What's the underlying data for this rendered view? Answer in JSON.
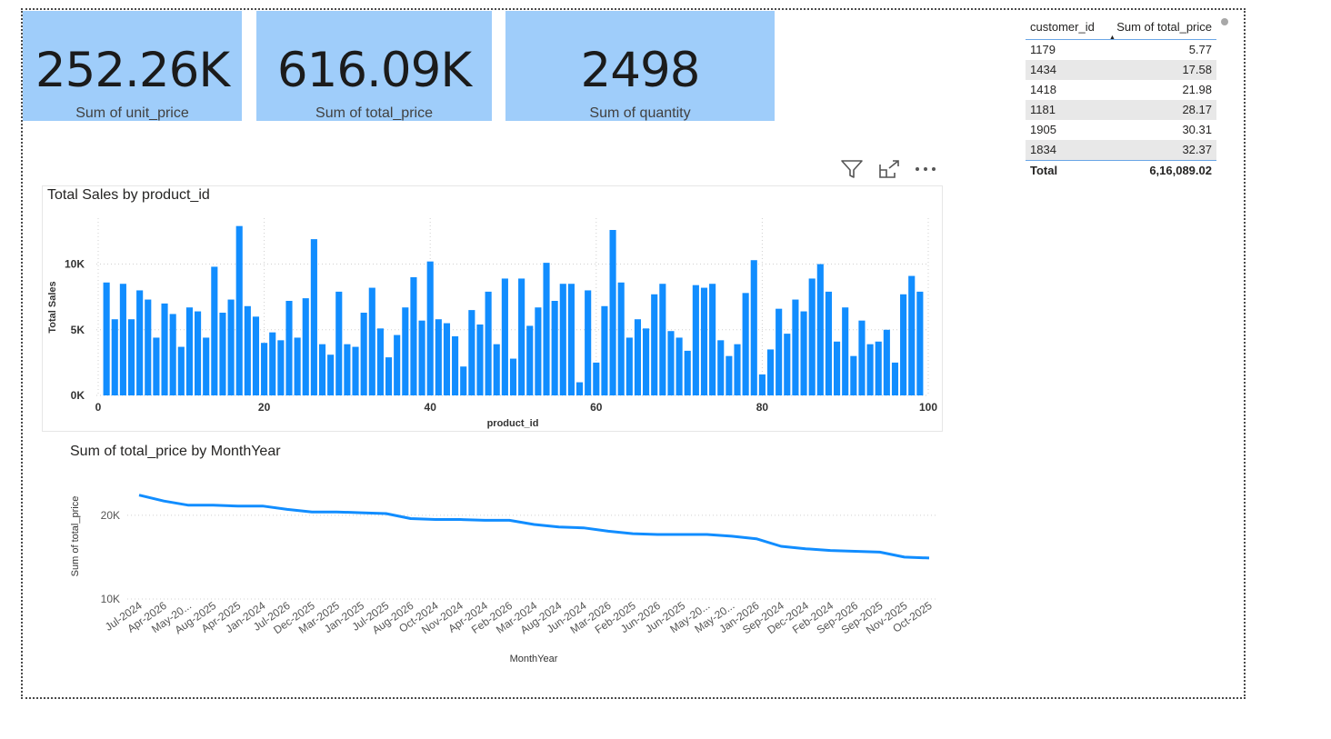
{
  "kpis": [
    {
      "value": "252.26K",
      "label": "Sum of unit_price"
    },
    {
      "value": "616.09K",
      "label": "Sum of total_price"
    },
    {
      "value": "2498",
      "label": "Sum of quantity"
    }
  ],
  "table": {
    "headers": [
      "customer_id",
      "Sum of total_price"
    ],
    "rows": [
      [
        "1179",
        "5.77"
      ],
      [
        "1434",
        "17.58"
      ],
      [
        "1418",
        "21.98"
      ],
      [
        "1181",
        "28.17"
      ],
      [
        "1905",
        "30.31"
      ],
      [
        "1834",
        "32.37"
      ]
    ],
    "total_label": "Total",
    "total_value": "6,16,089.02"
  },
  "toolbar": {
    "icons": [
      "filter-icon",
      "focus-mode-icon",
      "more-options-icon"
    ]
  },
  "colors": {
    "kpi_bg": "#9fcdfa",
    "bar": "#118dff",
    "line": "#118dff"
  },
  "chart_data": [
    {
      "type": "bar",
      "title": "Total Sales by product_id",
      "xlabel": "product_id",
      "ylabel": "Total Sales",
      "xlim": [
        0,
        100
      ],
      "ylim": [
        0,
        13500
      ],
      "xticks": [
        "0",
        "20",
        "40",
        "60",
        "80",
        "100"
      ],
      "yticks": [
        "0K",
        "5K",
        "10K"
      ],
      "grid": true,
      "x": [
        1,
        2,
        3,
        4,
        5,
        6,
        7,
        8,
        9,
        10,
        11,
        12,
        13,
        14,
        15,
        16,
        17,
        18,
        19,
        20,
        21,
        22,
        23,
        24,
        25,
        26,
        27,
        28,
        29,
        30,
        31,
        32,
        33,
        34,
        35,
        36,
        37,
        38,
        39,
        40,
        41,
        42,
        43,
        44,
        45,
        46,
        47,
        48,
        49,
        50,
        51,
        52,
        53,
        54,
        55,
        56,
        57,
        58,
        59,
        60,
        61,
        62,
        63,
        64,
        65,
        66,
        67,
        68,
        69,
        70,
        71,
        72,
        73,
        74,
        75,
        76,
        77,
        78,
        79,
        80,
        81,
        82,
        83,
        84,
        85,
        86,
        87,
        88,
        89,
        90,
        91,
        92,
        93,
        94,
        95,
        96,
        97,
        98,
        99
      ],
      "values": [
        8600,
        5800,
        8500,
        5800,
        8000,
        7300,
        4400,
        7000,
        6200,
        3700,
        6700,
        6400,
        4400,
        9800,
        6300,
        7300,
        12900,
        6800,
        6000,
        4000,
        4800,
        4200,
        7200,
        4400,
        7400,
        11900,
        3900,
        3100,
        7900,
        3900,
        3700,
        6300,
        8200,
        5100,
        2900,
        4600,
        6700,
        9000,
        5700,
        10200,
        5800,
        5500,
        4500,
        2200,
        6500,
        5400,
        7900,
        3900,
        8900,
        2800,
        8900,
        5300,
        6700,
        10100,
        7200,
        8500,
        8500,
        1000,
        8000,
        2500,
        6800,
        12600,
        8600,
        4400,
        5800,
        5100,
        7700,
        8500,
        4900,
        4400,
        3400,
        8400,
        8200,
        8500,
        4200,
        3000,
        3900,
        7800,
        10300,
        1600,
        3500,
        6600,
        4700,
        7300,
        6400,
        8900,
        10000,
        7900,
        4100,
        6700,
        3000,
        5700,
        3900,
        4100,
        5000,
        2500,
        7700,
        9100,
        7900
      ]
    },
    {
      "type": "line",
      "title": "Sum of total_price by MonthYear",
      "xlabel": "MonthYear",
      "ylabel": "Sum of total_price",
      "ylim": [
        10000,
        24000
      ],
      "yticks": [
        "10K",
        "20K"
      ],
      "grid": true,
      "x": [
        "Jul-2024",
        "Apr-2026",
        "May-20...",
        "Aug-2025",
        "Apr-2025",
        "Jan-2024",
        "Jul-2026",
        "Dec-2025",
        "Mar-2025",
        "Jan-2025",
        "Jul-2025",
        "Aug-2026",
        "Oct-2024",
        "Nov-2024",
        "Apr-2024",
        "Feb-2026",
        "Mar-2024",
        "Aug-2024",
        "Jun-2024",
        "Mar-2026",
        "Feb-2025",
        "Jun-2026",
        "Jun-2025",
        "May-20...",
        "May-20...",
        "Jan-2026",
        "Sep-2024",
        "Dec-2024",
        "Feb-2024",
        "Sep-2026",
        "Sep-2025",
        "Nov-2025",
        "Oct-2025"
      ],
      "values": [
        22400,
        21700,
        21200,
        21200,
        21100,
        21100,
        20700,
        20400,
        20400,
        20300,
        20200,
        19600,
        19500,
        19500,
        19400,
        19400,
        18900,
        18600,
        18500,
        18100,
        17800,
        17700,
        17700,
        17700,
        17500,
        17200,
        16300,
        16000,
        15800,
        15700,
        15600,
        15000,
        14900
      ]
    }
  ]
}
